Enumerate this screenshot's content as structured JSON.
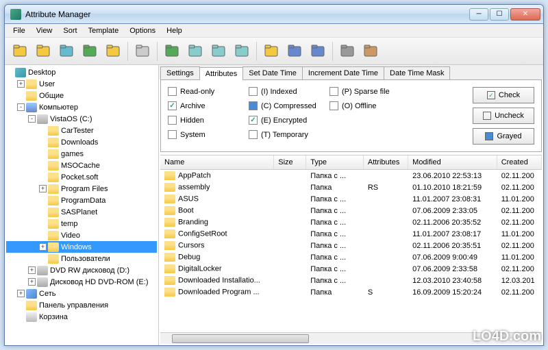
{
  "window": {
    "title": "Attribute Manager"
  },
  "menu": [
    "File",
    "View",
    "Sort",
    "Template",
    "Options",
    "Help"
  ],
  "toolbar_icons": [
    "new-folder-icon",
    "open-folder-icon",
    "home-icon",
    "refresh-icon",
    "up-folder-icon",
    "notes-icon",
    "apply-icon",
    "copy-attr-icon",
    "paste-attr-icon",
    "paste-attr2-icon",
    "task-icon",
    "save-icon",
    "save2-icon",
    "settings-icon",
    "help-icon"
  ],
  "tree": [
    {
      "d": 0,
      "exp": null,
      "icon": "desktop-ico",
      "label": "Desktop"
    },
    {
      "d": 1,
      "exp": "+",
      "icon": "folder",
      "label": "User"
    },
    {
      "d": 1,
      "exp": null,
      "icon": "folder",
      "label": "Общие"
    },
    {
      "d": 1,
      "exp": "-",
      "icon": "computer",
      "label": "Компьютер"
    },
    {
      "d": 2,
      "exp": "-",
      "icon": "drive",
      "label": "VistaOS (C:)"
    },
    {
      "d": 3,
      "exp": null,
      "icon": "folder",
      "label": "CarTester"
    },
    {
      "d": 3,
      "exp": null,
      "icon": "folder",
      "label": "Downloads"
    },
    {
      "d": 3,
      "exp": null,
      "icon": "folder",
      "label": "games"
    },
    {
      "d": 3,
      "exp": null,
      "icon": "folder",
      "label": "MSOCache"
    },
    {
      "d": 3,
      "exp": null,
      "icon": "folder",
      "label": "Pocket.soft"
    },
    {
      "d": 3,
      "exp": "+",
      "icon": "folder",
      "label": "Program Files"
    },
    {
      "d": 3,
      "exp": null,
      "icon": "folder",
      "label": "ProgramData"
    },
    {
      "d": 3,
      "exp": null,
      "icon": "folder",
      "label": "SASPlanet"
    },
    {
      "d": 3,
      "exp": null,
      "icon": "folder",
      "label": "temp"
    },
    {
      "d": 3,
      "exp": null,
      "icon": "folder",
      "label": "Video"
    },
    {
      "d": 3,
      "exp": "+",
      "icon": "folder",
      "label": "Windows",
      "sel": true
    },
    {
      "d": 3,
      "exp": null,
      "icon": "folder",
      "label": "Пользователи"
    },
    {
      "d": 2,
      "exp": "+",
      "icon": "drive",
      "label": "DVD RW дисковод (D:)"
    },
    {
      "d": 2,
      "exp": "+",
      "icon": "drive",
      "label": "Дисковод HD DVD-ROM (E:)"
    },
    {
      "d": 1,
      "exp": "+",
      "icon": "network-ico",
      "label": "Сеть"
    },
    {
      "d": 1,
      "exp": null,
      "icon": "folder",
      "label": "Панель управления"
    },
    {
      "d": 1,
      "exp": null,
      "icon": "bin-ico",
      "label": "Корзина"
    }
  ],
  "tabs": [
    "Settings",
    "Attributes",
    "Set Date Time",
    "Increment Date Time",
    "Date Time Mask"
  ],
  "active_tab": 1,
  "attrs": {
    "col1": [
      {
        "l": "Read-only",
        "s": ""
      },
      {
        "l": "Archive",
        "s": "checked"
      },
      {
        "l": "Hidden",
        "s": ""
      },
      {
        "l": "System",
        "s": ""
      }
    ],
    "col2": [
      {
        "l": "(I) Indexed",
        "s": ""
      },
      {
        "l": "(C) Compressed",
        "s": "gray"
      },
      {
        "l": "(E) Encrypted",
        "s": "checked"
      },
      {
        "l": "(T) Temporary",
        "s": ""
      }
    ],
    "col3": [
      {
        "l": "(P) Sparse file",
        "s": ""
      },
      {
        "l": "(O) Offline",
        "s": ""
      }
    ]
  },
  "attr_buttons": [
    {
      "l": "Check",
      "s": "c"
    },
    {
      "l": "Uncheck",
      "s": ""
    },
    {
      "l": "Grayed",
      "s": "g"
    }
  ],
  "columns": [
    "Name",
    "Size",
    "Type",
    "Attributes",
    "Modified",
    "Created"
  ],
  "files": [
    {
      "n": "AppPatch",
      "t": "Папка с ...",
      "a": "",
      "m": "23.06.2010 22:53:13",
      "c": "02.11.200"
    },
    {
      "n": "assembly",
      "t": "Папка",
      "a": "RS",
      "m": "01.10.2010 18:21:59",
      "c": "02.11.200"
    },
    {
      "n": "ASUS",
      "t": "Папка с ...",
      "a": "",
      "m": "11.01.2007 23:08:31",
      "c": "11.01.200"
    },
    {
      "n": "Boot",
      "t": "Папка с ...",
      "a": "",
      "m": "07.06.2009 2:33:05",
      "c": "02.11.200"
    },
    {
      "n": "Branding",
      "t": "Папка с ...",
      "a": "",
      "m": "02.11.2006 20:35:52",
      "c": "02.11.200"
    },
    {
      "n": "ConfigSetRoot",
      "t": "Папка с ...",
      "a": "",
      "m": "11.01.2007 23:08:17",
      "c": "11.01.200"
    },
    {
      "n": "Cursors",
      "t": "Папка с ...",
      "a": "",
      "m": "02.11.2006 20:35:51",
      "c": "02.11.200"
    },
    {
      "n": "Debug",
      "t": "Папка с ...",
      "a": "",
      "m": "07.06.2009 9:00:49",
      "c": "11.01.200"
    },
    {
      "n": "DigitalLocker",
      "t": "Папка с ...",
      "a": "",
      "m": "07.06.2009 2:33:58",
      "c": "02.11.200"
    },
    {
      "n": "Downloaded Installatio...",
      "t": "Папка с ...",
      "a": "",
      "m": "12.03.2010 23:40:58",
      "c": "12.03.201"
    },
    {
      "n": "Downloaded Program ...",
      "t": "Папка",
      "a": "S",
      "m": "16.09.2009 15:20:24",
      "c": "02.11.200"
    }
  ],
  "watermark": "LO4D.com"
}
